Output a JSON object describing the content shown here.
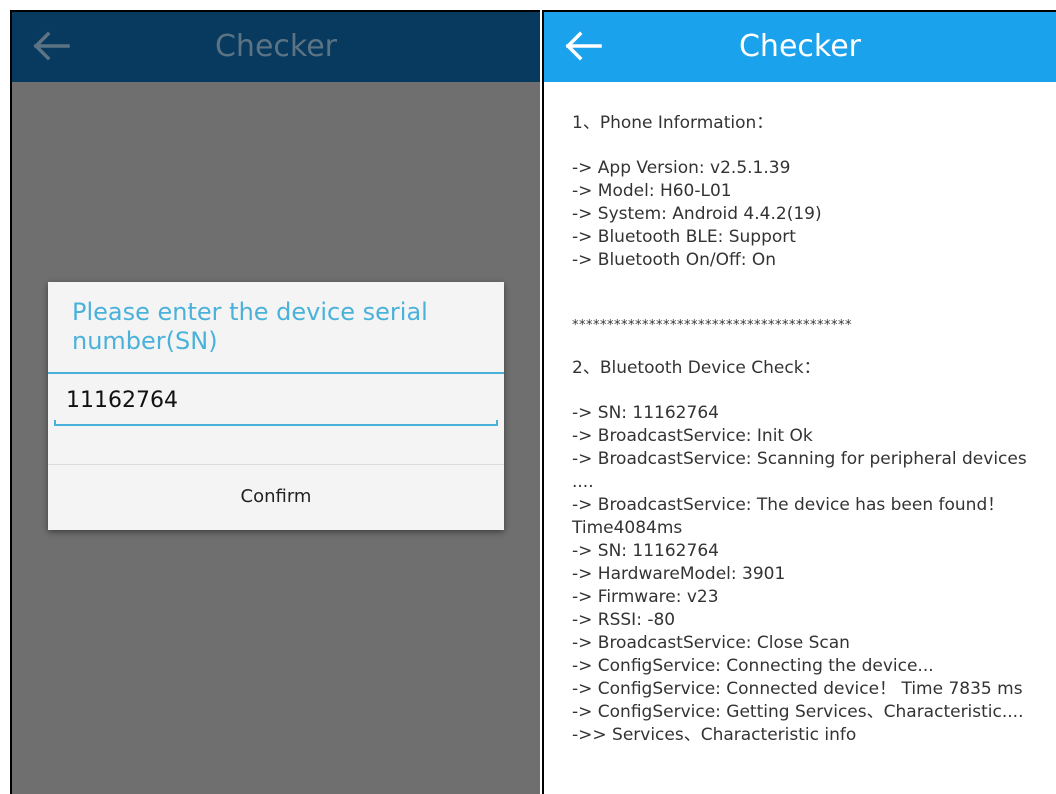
{
  "left": {
    "title": "Checker",
    "dialog": {
      "title": "Please enter the device serial number(SN)",
      "input_value": "11162764",
      "confirm_label": "Confirm"
    },
    "colors": {
      "bar": "#073a5e",
      "overlay": "#6f6f6f",
      "accent": "#4ab2da"
    },
    "back_icon": "arrow-left-icon"
  },
  "right": {
    "title": "Checker",
    "back_icon": "arrow-left-icon",
    "colors": {
      "bar": "#1ba2ec"
    },
    "section1": {
      "heading": "1、Phone Information：",
      "lines": [
        "-> App Version: v2.5.1.39",
        "-> Model: H60-L01",
        "-> System: Android 4.4.2(19)",
        "-> Bluetooth BLE: Support",
        "-> Bluetooth On/Off: On"
      ]
    },
    "separator": "****************************************",
    "section2": {
      "heading": "2、Bluetooth Device Check：",
      "lines": [
        "-> SN: 11162764",
        "-> BroadcastService: Init Ok",
        "-> BroadcastService: Scanning for peripheral devices ....",
        "-> BroadcastService: The device has been found！ Time4084ms",
        "-> SN: 11162764",
        "-> HardwareModel: 3901",
        "-> Firmware: v23",
        "-> RSSI: -80",
        "-> BroadcastService: Close Scan",
        "-> ConfigService: Connecting the device...",
        "-> ConfigService: Connected device！ Time 7835 ms",
        "-> ConfigService: Getting Services、Characteristic....",
        "->> Services、Characteristic info"
      ]
    }
  }
}
